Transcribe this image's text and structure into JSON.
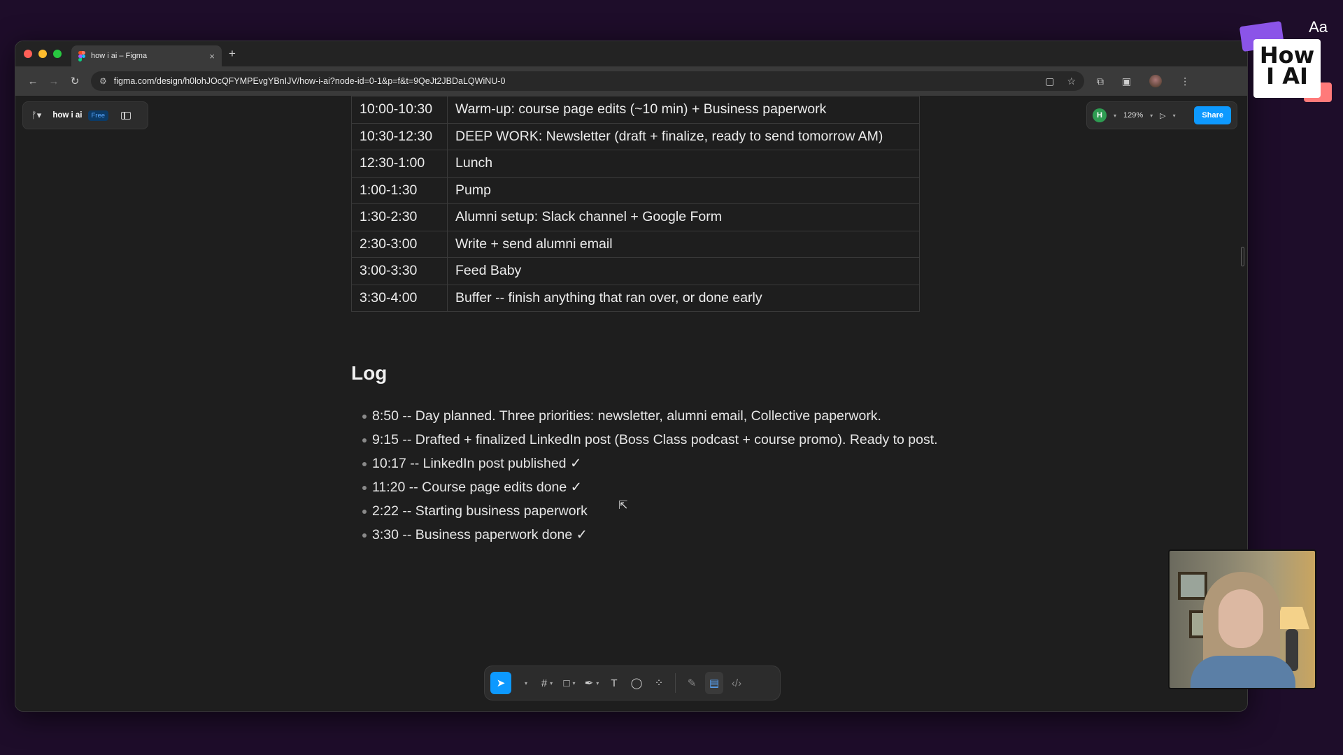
{
  "browser": {
    "tab_title": "how i ai – Figma",
    "tab_close": "×",
    "new_tab": "+",
    "url": "figma.com/design/h0lohJOcQFYMPEvgYBnIJV/how-i-ai?node-id=0-1&p=f&t=9QeJt2JBDaLQWiNU-0"
  },
  "figma": {
    "file_name": "how i ai",
    "plan_badge": "Free",
    "user_initial": "H",
    "zoom": "129%",
    "share_label": "Share"
  },
  "schedule": [
    {
      "time": "10:00-10:30",
      "task": "Warm-up: course page edits (~10 min) + Business paperwork"
    },
    {
      "time": "10:30-12:30",
      "task": "DEEP WORK: Newsletter (draft + finalize, ready to send tomorrow AM)"
    },
    {
      "time": "12:30-1:00",
      "task": "Lunch"
    },
    {
      "time": "1:00-1:30",
      "task": "Pump"
    },
    {
      "time": "1:30-2:30",
      "task": "Alumni setup: Slack channel + Google Form"
    },
    {
      "time": "2:30-3:00",
      "task": "Write + send alumni email"
    },
    {
      "time": "3:00-3:30",
      "task": "Feed Baby"
    },
    {
      "time": "3:30-4:00",
      "task": "Buffer -- finish anything that ran over, or done early"
    }
  ],
  "log": {
    "title": "Log",
    "entries": [
      "8:50 -- Day planned. Three priorities: newsletter, alumni email, Collective paperwork.",
      "9:15 -- Drafted + finalized LinkedIn post (Boss Class podcast + course promo). Ready to post.",
      "10:17 -- LinkedIn post published ✓",
      "11:20 -- Course page edits done ✓",
      "2:22 -- Starting business paperwork",
      "3:30 -- Business paperwork done ✓"
    ]
  },
  "overlay": {
    "logo_text_top": "Aa",
    "logo_line1": "How",
    "logo_line2": "I AI"
  },
  "colors": {
    "background": "#1e0d2a",
    "canvas": "#1e1e1e",
    "accent": "#0d99ff"
  }
}
